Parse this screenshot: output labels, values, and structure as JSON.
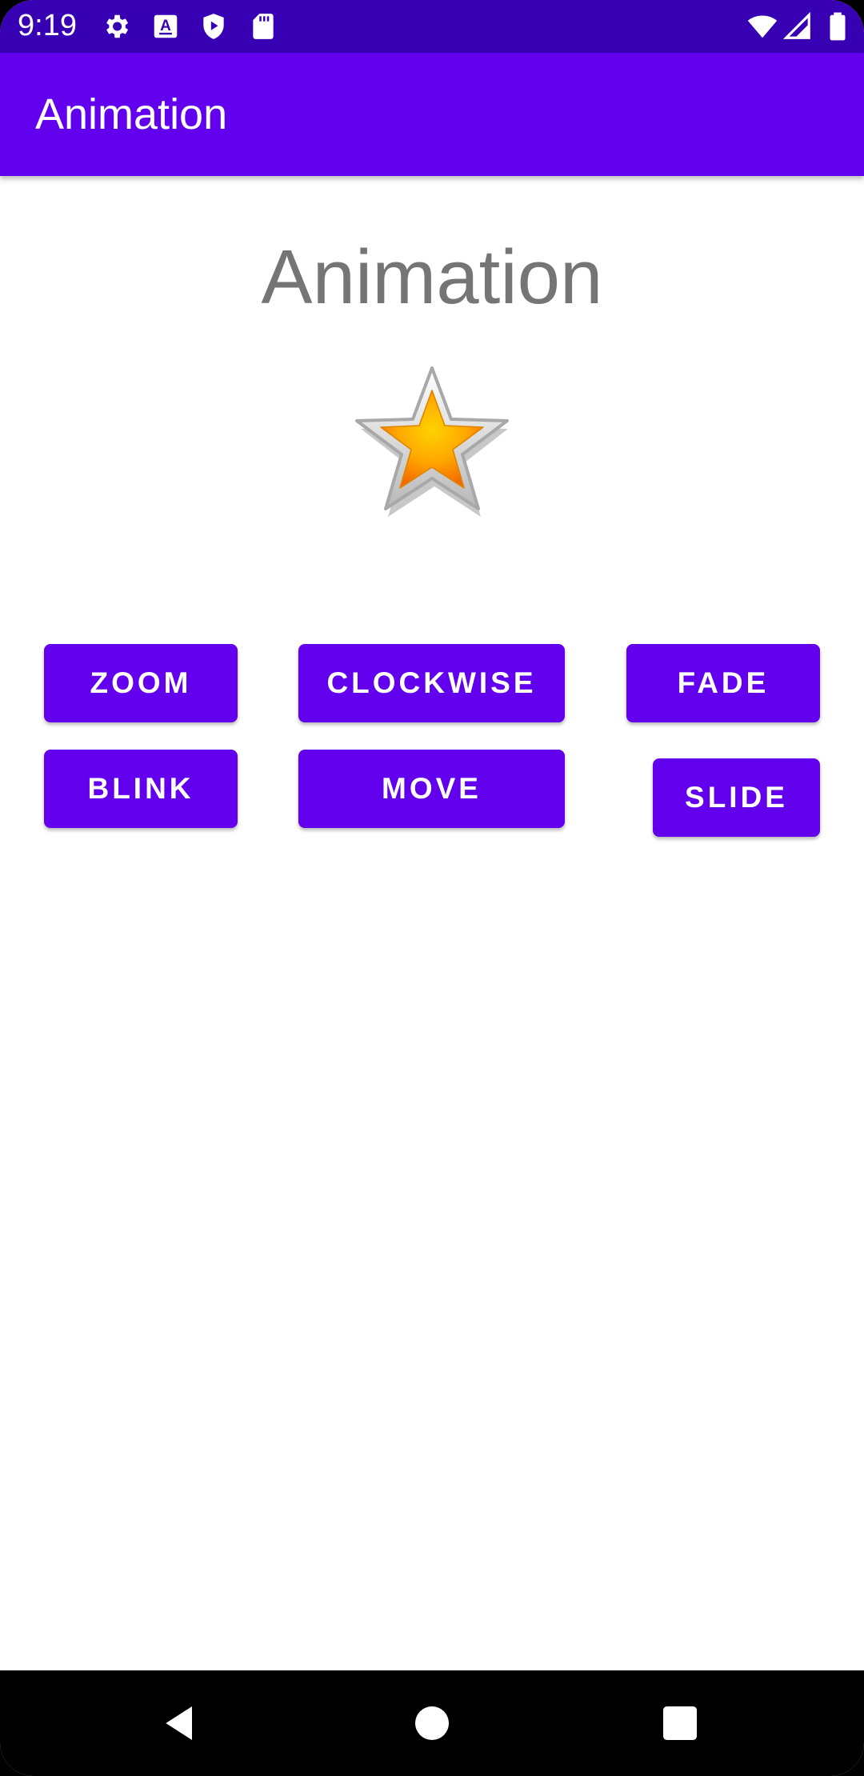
{
  "status_bar": {
    "time": "9:19",
    "icons": [
      "settings-icon",
      "a-keyboard-icon",
      "shield-play-icon",
      "sd-card-icon",
      "wifi-icon",
      "cell-signal-icon",
      "battery-icon"
    ]
  },
  "app_bar": {
    "title": "Animation",
    "color": "#6200EE"
  },
  "main": {
    "heading": "Animation",
    "image": "star-icon",
    "buttons": {
      "zoom": "ZOOM",
      "clockwise": "CLOCKWISE",
      "fade": "FADE",
      "blink": "BLINK",
      "move": "MOVE",
      "slide": "SLIDE"
    }
  },
  "nav_bar": {
    "icons": [
      "back-icon",
      "home-icon",
      "recents-icon"
    ]
  },
  "colors": {
    "primary": "#6200EE",
    "primary_dark": "#3700B3",
    "heading_text": "#757575"
  }
}
